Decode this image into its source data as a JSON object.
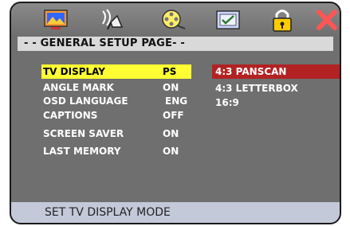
{
  "icons": [
    "tv-screen-icon",
    "audio-icon",
    "film-reel-icon",
    "checklist-icon",
    "lock-icon",
    "close-x-icon"
  ],
  "page_title": "- -    GENERAL SETUP PAGE- -",
  "settings": [
    {
      "label": "TV DISPLAY",
      "value": "PS"
    },
    {
      "label": "ANGLE MARK",
      "value": "ON"
    },
    {
      "label": "OSD LANGUAGE",
      "value": "ENG"
    },
    {
      "label": "CAPTIONS",
      "value": "OFF"
    },
    {
      "label": "SCREEN SAVER",
      "value": "ON"
    },
    {
      "label": "LAST MEMORY",
      "value": "ON"
    }
  ],
  "options": [
    "4:3 PANSCAN",
    "4:3 LETTERBOX",
    "16:9"
  ],
  "status_text": "SET TV DISPLAY MODE",
  "colors": {
    "highlight": "#ffff33",
    "selected_option": "#b22222",
    "panel": "#6f6f6f",
    "status_bar": "#c3c9d9"
  }
}
